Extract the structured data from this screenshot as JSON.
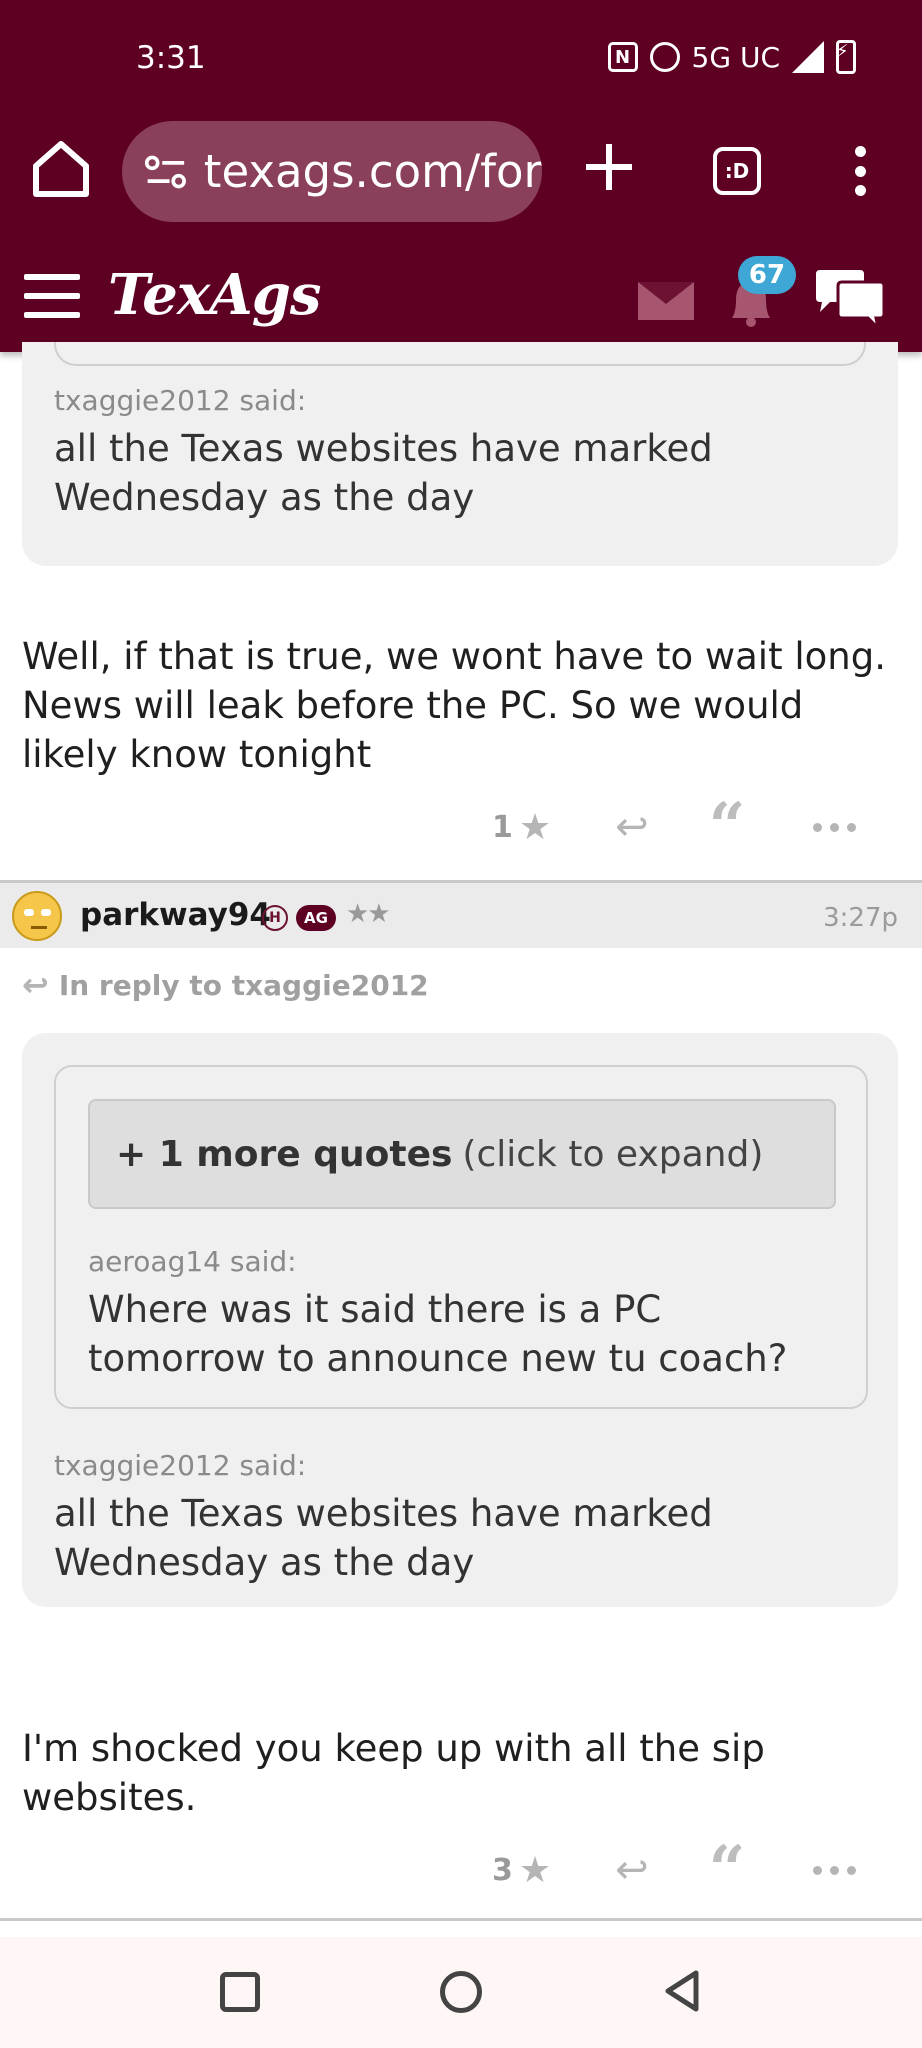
{
  "status_bar": {
    "time": "3:31",
    "network": "5G UC",
    "icons": [
      "nfc-icon",
      "alarm-icon",
      "signal-icon",
      "battery-charging-icon"
    ]
  },
  "browser": {
    "url_prefix": "texags.com/for",
    "tab_button_label": ":D",
    "icons": [
      "home-icon",
      "site-settings-icon",
      "new-tab-icon",
      "tabs-icon",
      "menu-icon"
    ]
  },
  "site_header": {
    "logo": "TexAgs",
    "notification_count": "67",
    "icons": [
      "hamburger-icon",
      "mail-icon",
      "bell-icon",
      "chat-icon"
    ]
  },
  "post1": {
    "quote_author": "txaggie2012 said:",
    "quote_text": "all the Texas websites have marked Wednesday as the day",
    "body": "Well, if that is true, we wont have to wait long. News will leak before the PC. So we would likely know tonight",
    "star_count": "1"
  },
  "post2": {
    "username": "parkway94",
    "badge_h": "H",
    "badge_ag": "AG",
    "rank_stars": "★★",
    "time": "3:27p",
    "in_reply_to": "In reply to txaggie2012",
    "expand_bold": "+ 1 more quotes",
    "expand_rest": "(click to expand)",
    "inner_quote_author": "aeroag14 said:",
    "inner_quote_text": "Where was it said there is a PC tomorrow to announce new tu coach?",
    "quote_author": "txaggie2012 said:",
    "quote_text": "all the Texas websites have marked Wednesday as the day",
    "body": "I'm shocked you keep up with all the sip websites.",
    "star_count": "3"
  },
  "colors": {
    "brand_maroon": "#5e0024",
    "badge_blue": "#3fa7d6",
    "quote_bg": "#f0f0f0"
  }
}
